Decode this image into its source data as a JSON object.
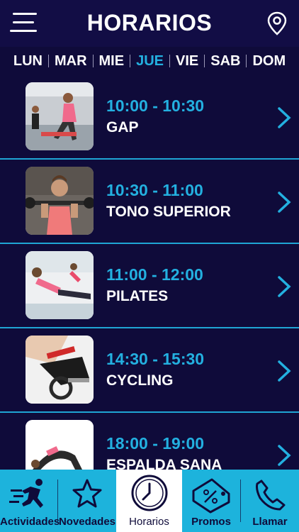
{
  "header": {
    "title": "HORARIOS"
  },
  "days": [
    {
      "label": "LUN",
      "active": false
    },
    {
      "label": "MAR",
      "active": false
    },
    {
      "label": "MIE",
      "active": false
    },
    {
      "label": "JUE",
      "active": true
    },
    {
      "label": "VIE",
      "active": false
    },
    {
      "label": "SAB",
      "active": false
    },
    {
      "label": "DOM",
      "active": false
    }
  ],
  "classes": [
    {
      "time": "10:00 - 10:30",
      "name": "GAP"
    },
    {
      "time": "10:30 - 11:00",
      "name": "TONO SUPERIOR"
    },
    {
      "time": "11:00 - 12:00",
      "name": "PILATES"
    },
    {
      "time": "14:30 - 15:30",
      "name": "CYCLING"
    },
    {
      "time": "18:00 - 19:00",
      "name": "ESPALDA SANA"
    }
  ],
  "tabs": [
    {
      "label": "Actividades",
      "icon": "runner-icon"
    },
    {
      "label": "Novedades",
      "icon": "star-icon"
    },
    {
      "label": "Horarios",
      "icon": "clock-icon",
      "active": true
    },
    {
      "label": "Promos",
      "icon": "tag-percent-icon"
    },
    {
      "label": "Llamar",
      "icon": "phone-icon"
    }
  ],
  "colors": {
    "background": "#0f0b3a",
    "accent": "#23b0e0",
    "tabbar": "#1db3dc"
  }
}
